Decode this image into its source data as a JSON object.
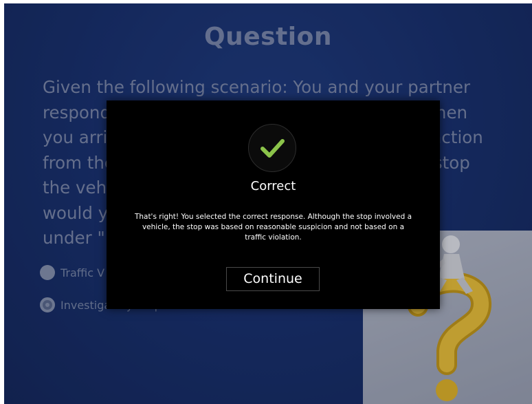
{
  "slide": {
    "title": "Question",
    "question": {
      "line1": "Given the following scenario: You and your partner",
      "line2": "respond to a call of an automobile accident. When",
      "line3": "you arrive you observe what looks like a transaction",
      "line4": "from the driver of the vehicle. You perform an stop",
      "line5": "the vehicle and driver. What type of stop",
      "line6": "would you record in the Racial Profile System",
      "line7_prefix": "under ",
      "line7_quote": "\""
    },
    "options": [
      {
        "label": "Traffic V",
        "selected": false
      },
      {
        "label": "Investigatory Stop",
        "selected": true
      }
    ]
  },
  "feedback": {
    "icon": "checkmark-icon",
    "title": "Correct",
    "message": "That's right!  You selected the correct response. Although the stop involved a vehicle, the stop was based on reasonable suspicion and not based on a traffic violation.",
    "button_label": "Continue"
  },
  "colors": {
    "slide_bg": "#19306a",
    "check": "#8bc34a",
    "modal_bg": "#000000"
  }
}
